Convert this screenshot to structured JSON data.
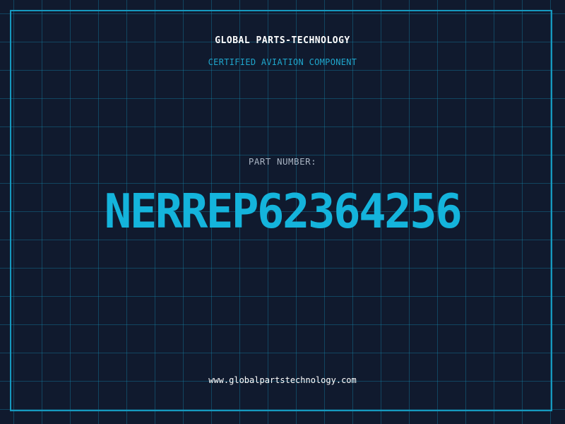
{
  "header": {
    "company": "GLOBAL PARTS-TECHNOLOGY",
    "tagline": "CERTIFIED AVIATION COMPONENT"
  },
  "part": {
    "label": "PART NUMBER:",
    "number": "NERREP62364256"
  },
  "footer": {
    "url": "www.globalpartstechnology.com"
  },
  "colors": {
    "background": "#101a2e",
    "grid": "#148caf",
    "accent": "#14b4dc",
    "frame": "#1699bf"
  }
}
